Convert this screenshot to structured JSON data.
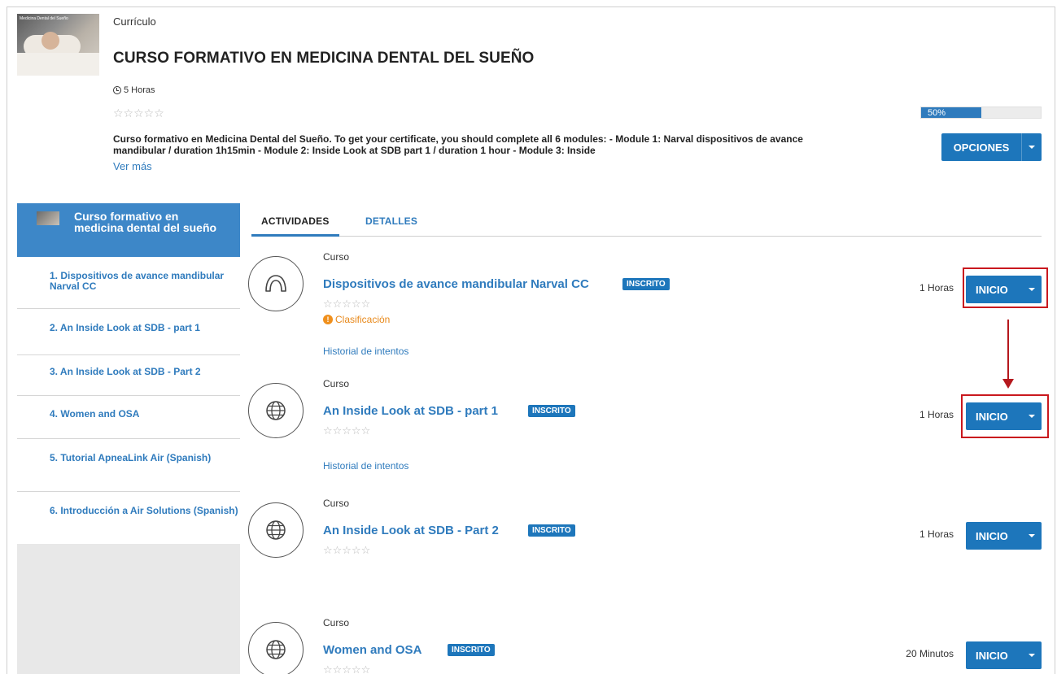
{
  "header": {
    "label": "Currículo",
    "title": "CURSO FORMATIVO EN MEDICINA DENTAL DEL SUEÑO",
    "duration": "5 Horas",
    "rating_stars": "☆☆☆☆☆",
    "description": "Curso formativo en Medicina Dental del Sueño. To get your certificate, you should complete all 6 modules: - Module 1: Narval dispositivos de avance mandibular / duration 1h15min - Module 2: Inside Look at SDB part 1 / duration 1 hour - Module 3: Inside",
    "see_more": "Ver más",
    "thumbnail_text": "Medicina Dental del Sueño",
    "progress_text": "50%",
    "progress_value": 0.5,
    "options_button": "OPCIONES"
  },
  "sidebar": {
    "header_label": "Curso formativo en medicina dental del sueño",
    "items": [
      {
        "label": "1. Dispositivos de avance mandibular Narval CC"
      },
      {
        "label": "2. An Inside Look at SDB - part 1"
      },
      {
        "label": "3. An Inside Look at SDB - Part 2"
      },
      {
        "label": "4. Women and OSA"
      },
      {
        "label": "5. Tutorial ApneaLink Air (Spanish)"
      },
      {
        "label": "6. Introducción a Air Solutions (Spanish)"
      }
    ]
  },
  "tabs": {
    "activities": "ACTIVIDADES",
    "details": "DETALLES"
  },
  "activities": [
    {
      "type": "Curso",
      "name": "Dispositivos de avance mandibular Narval CC",
      "badge": "INSCRITO",
      "stars": "☆☆☆☆☆",
      "warning": "Clasificación",
      "history": "Historial de intentos",
      "duration": "1 Horas",
      "button": "INICIO",
      "icon": "mouthguard-icon"
    },
    {
      "type": "Curso",
      "name": "An Inside Look at SDB - part 1",
      "badge": "INSCRITO",
      "stars": "☆☆☆☆☆",
      "history": "Historial de intentos",
      "duration": "1 Horas",
      "button": "INICIO",
      "icon": "globe-icon"
    },
    {
      "type": "Curso",
      "name": "An Inside Look at SDB - Part 2",
      "badge": "INSCRITO",
      "stars": "☆☆☆☆☆",
      "duration": "1 Horas",
      "button": "INICIO",
      "icon": "globe-icon"
    },
    {
      "type": "Curso",
      "name": "Women and OSA",
      "badge": "INSCRITO",
      "stars": "☆☆☆☆☆",
      "duration": "20 Minutos",
      "button": "INICIO",
      "icon": "globe-icon"
    }
  ],
  "colors": {
    "accent": "#1d76bb",
    "link": "#2f7bbd",
    "sidebar_header": "#3d87c8",
    "warning": "#f0901d",
    "annotation": "#c9181e"
  }
}
